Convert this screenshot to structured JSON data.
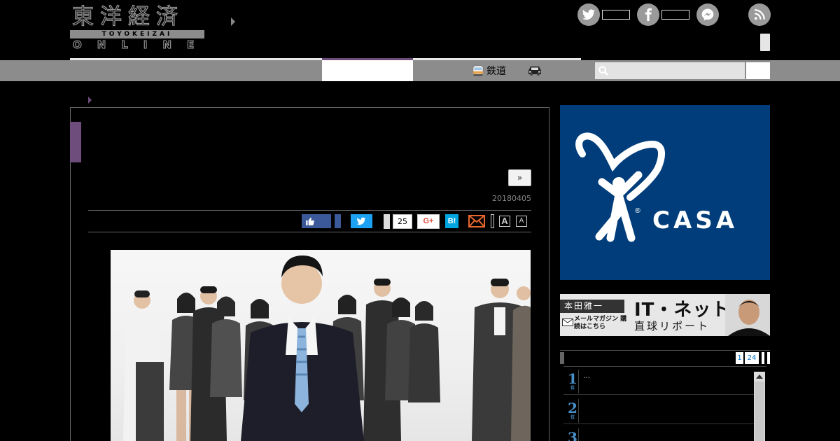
{
  "logo": {
    "kanji": "東洋経済",
    "romaji": "TOYOKEIZAI",
    "online": "ONLINE"
  },
  "header": {
    "social": [
      {
        "name": "twitter",
        "icon": "twitter-icon"
      },
      {
        "name": "facebook",
        "icon": "facebook-icon"
      },
      {
        "name": "messenger",
        "icon": "messenger-icon"
      },
      {
        "name": "rss",
        "icon": "rss-icon"
      }
    ]
  },
  "nav": {
    "items": [
      {
        "label": "鉄道",
        "icon": "train-icon"
      },
      {
        "label": "",
        "icon": "car-icon"
      }
    ],
    "search": {
      "value": "",
      "placeholder": ""
    }
  },
  "article": {
    "next_label": "»",
    "date": "20180405",
    "share": {
      "pocket_count": "25",
      "gplus_label": "G+",
      "hatena_label": "B!",
      "font_large": "A",
      "font_small": "A"
    }
  },
  "sidebar": {
    "ad": {
      "brand": "CASA",
      "registered": "®"
    },
    "banner": {
      "author": "本田雅一",
      "mail_text": "メールマガジン 購読はこちら",
      "headline": "IT・ネット",
      "subline": "直球リポート"
    },
    "ranking": {
      "tabs": [
        "1",
        "24"
      ],
      "items": [
        {
          "rank": "1",
          "suffix": "位",
          "title": "…"
        },
        {
          "rank": "2",
          "suffix": "位",
          "title": ""
        },
        {
          "rank": "3",
          "suffix": "位",
          "title": ""
        }
      ]
    }
  },
  "colors": {
    "accent_purple": "#6e4d7c",
    "nav_gray": "#8c8c8c",
    "ad_blue": "#003d7a",
    "twitter_blue": "#1da1f2",
    "facebook_blue": "#3b5998",
    "hatena_blue": "#00a4de",
    "gplus_red": "#dd4b39",
    "rank_blue": "#4a90c8"
  }
}
